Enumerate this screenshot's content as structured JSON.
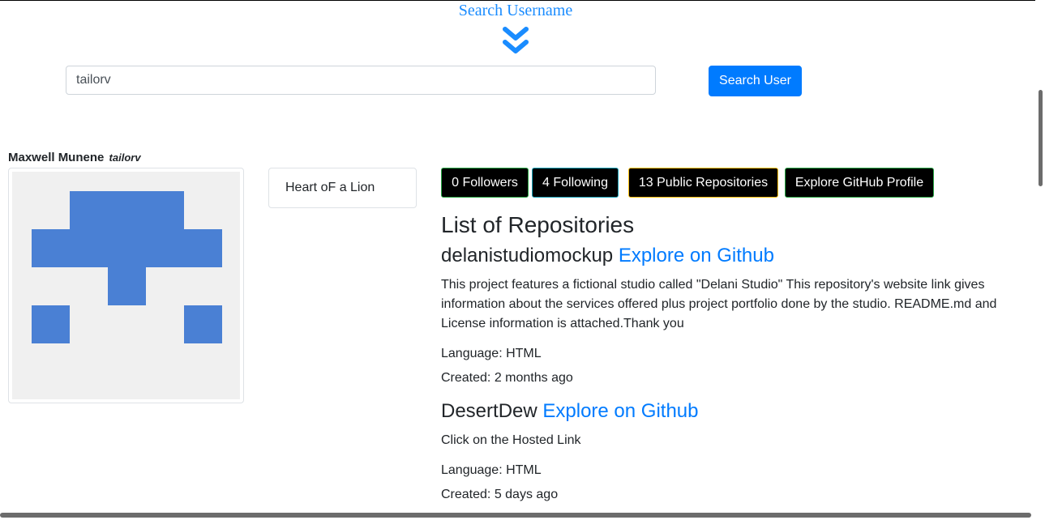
{
  "header": {
    "search_title": "Search Username",
    "chevron_icon": "double-chevron-down-icon"
  },
  "search": {
    "value": "tailorv",
    "button_label": "Search User"
  },
  "profile": {
    "name": "Maxwell Munene",
    "username": "tailorv",
    "bio": "Heart oF a Lion",
    "avatar_colors": {
      "fill": "#4a80d4",
      "background": "#f0f0f0"
    }
  },
  "stats": {
    "followers": "0 Followers",
    "following": "4 Following",
    "public_repos": "13 Public Repositories",
    "explore_profile": "Explore GitHub Profile"
  },
  "repositories": {
    "heading": "List of Repositories",
    "items": [
      {
        "name": "delanistudiomockup",
        "link_label": "Explore on Github",
        "description": "This project features a fictional studio called \"Delani Studio\" This repository's website link gives information about the services offered plus project portfolio done by the studio. README.md and License information is attached.Thank you",
        "language": "Language: HTML",
        "created": "Created: 2 months ago"
      },
      {
        "name": "DesertDew",
        "link_label": "Explore on Github",
        "description": "Click on the Hosted Link",
        "language": "Language: HTML",
        "created": "Created: 5 days ago"
      }
    ]
  },
  "colors": {
    "accent": "#007bff",
    "title_blue": "#1a8cff",
    "followers_border": "#28a745",
    "following_border": "#17a2b8",
    "repos_border": "#ffc107",
    "explore_border": "#28a745"
  }
}
